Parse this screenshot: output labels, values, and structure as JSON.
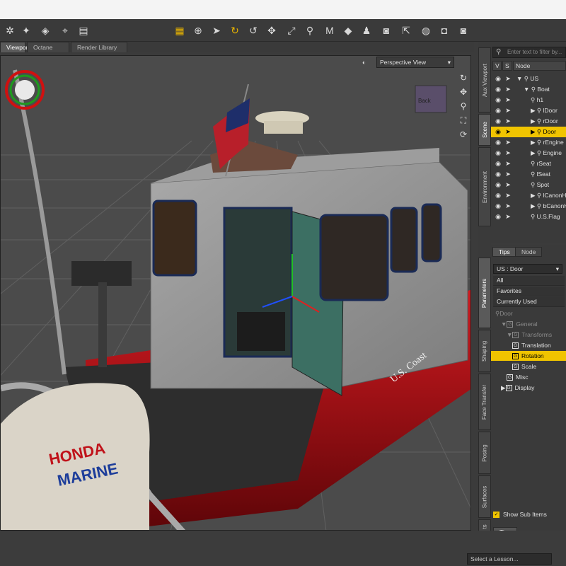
{
  "toolbar": {
    "icons": [
      "gear-icon",
      "magic-wand-icon",
      "node-weight-icon",
      "region-icon",
      "panel-toggle-icon",
      "tool-grid-icon",
      "universal-tool-icon",
      "pointer-icon",
      "rotate-tool-icon",
      "twist-icon",
      "move-icon",
      "scale-icon",
      "joint-editor-icon",
      "text-tool-icon",
      "surface-selection-icon",
      "figure-icon",
      "camera-icon",
      "pointer-select-icon",
      "spot-render-icon",
      "render-settings-icon",
      "render-icon"
    ]
  },
  "tabs": [
    "Viewport",
    "Octane",
    "Render Library"
  ],
  "viewport": {
    "view_mode": "Perspective View",
    "cube_label": "Back",
    "texts": [
      "U.S. Coast",
      "HONDA",
      "MARINE"
    ]
  },
  "scene": {
    "search_placeholder": "Enter text to filter by...",
    "col_v": "V",
    "col_s": "S",
    "col_node": "Node",
    "rows": [
      {
        "label": "US",
        "expander": "▼"
      },
      {
        "label": "Boat",
        "expander": "▼"
      },
      {
        "label": "h1",
        "expander": ""
      },
      {
        "label": "lDoor",
        "expander": "▶"
      },
      {
        "label": "rDoor",
        "expander": "▶"
      },
      {
        "label": "Door",
        "expander": "▶",
        "selected": true
      },
      {
        "label": "rEngine",
        "expander": "▶"
      },
      {
        "label": "Engine",
        "expander": "▶"
      },
      {
        "label": "rSeat",
        "expander": ""
      },
      {
        "label": "lSeat",
        "expander": ""
      },
      {
        "label": "Spot",
        "expander": ""
      },
      {
        "label": "lCanonH",
        "expander": "▶"
      },
      {
        "label": "bCanonH",
        "expander": "▶"
      },
      {
        "label": "U.S.Flag",
        "expander": ""
      }
    ]
  },
  "right_tabs": [
    "Aux Viewport",
    "Scene",
    "Environment"
  ],
  "param_vtabs": [
    "Parameters",
    "Shaping",
    "Face Transfer",
    "Posing",
    "Surfaces",
    "ts"
  ],
  "panel_tabs": [
    "Tips",
    "Node"
  ],
  "params": {
    "node_selector": "US : Door",
    "filters": [
      "All",
      "Favorites",
      "Currently Used"
    ],
    "tree": [
      {
        "label": "Door",
        "dim": true,
        "icon": "bone"
      },
      {
        "label": "General",
        "dim": true,
        "icon": "G",
        "exp": "▼"
      },
      {
        "label": "Transforms",
        "dim": true,
        "icon": "G",
        "exp": "▼"
      },
      {
        "label": "Translation",
        "icon": "G"
      },
      {
        "label": "Rotation",
        "icon": "G",
        "selected": true
      },
      {
        "label": "Scale",
        "icon": "G"
      },
      {
        "label": "Misc",
        "icon": "G"
      },
      {
        "label": "Display",
        "icon": "G",
        "exp": "▶"
      }
    ],
    "show_sub_items": "Show Sub Items",
    "bottom_tab": "Tips"
  },
  "lesson_select": "Select a Lesson...",
  "colors": {
    "selection": "#f0c400",
    "panel": "#3a3a3a",
    "viewport": "#4b4b4b",
    "hull_red": "#c0121a"
  }
}
